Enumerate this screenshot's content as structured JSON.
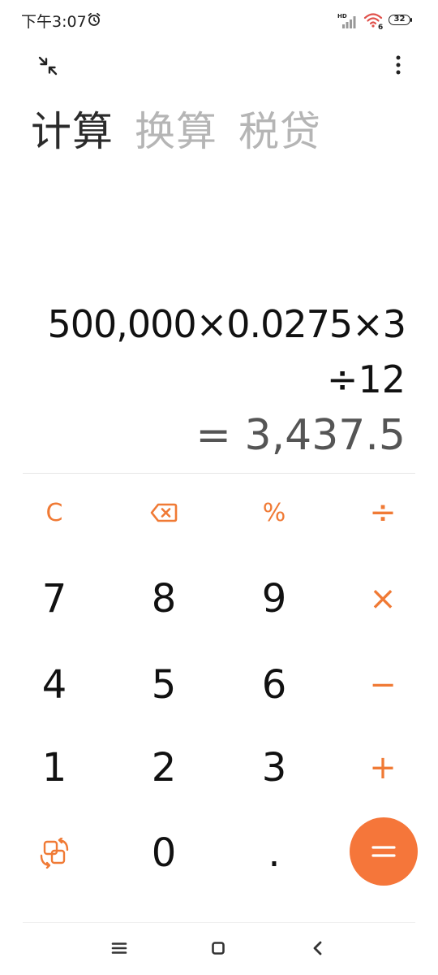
{
  "status_bar": {
    "time": "下午3:07",
    "battery": "32"
  },
  "tabs": [
    {
      "label": "计算",
      "active": true
    },
    {
      "label": "换算",
      "active": false
    },
    {
      "label": "税贷",
      "active": false
    }
  ],
  "display": {
    "expression_line1": "500,000×0.0275×3",
    "expression_line2": "÷12",
    "result": "= 3,437.5"
  },
  "keys": {
    "clear": "C",
    "percent": "%",
    "divide": "÷",
    "multiply": "×",
    "minus": "−",
    "plus": "+",
    "seven": "7",
    "eight": "8",
    "nine": "9",
    "four": "4",
    "five": "5",
    "six": "6",
    "one": "1",
    "two": "2",
    "three": "3",
    "zero": "0",
    "dot": "."
  },
  "colors": {
    "accent": "#f5763a",
    "text": "#111111",
    "result": "#555555",
    "inactive_tab": "#b5b5b5"
  },
  "icons": {
    "alarm": "alarm-clock-icon",
    "signal": "hd-signal-icon",
    "wifi": "wifi-6-icon",
    "collapse": "collapse-arrows-icon",
    "more": "more-vertical-icon",
    "backspace": "backspace-icon",
    "switch": "rotate-switch-icon",
    "equals": "equals-icon",
    "nav_menu": "menu-lines-icon",
    "nav_home": "home-square-icon",
    "nav_back": "back-chevron-icon"
  }
}
